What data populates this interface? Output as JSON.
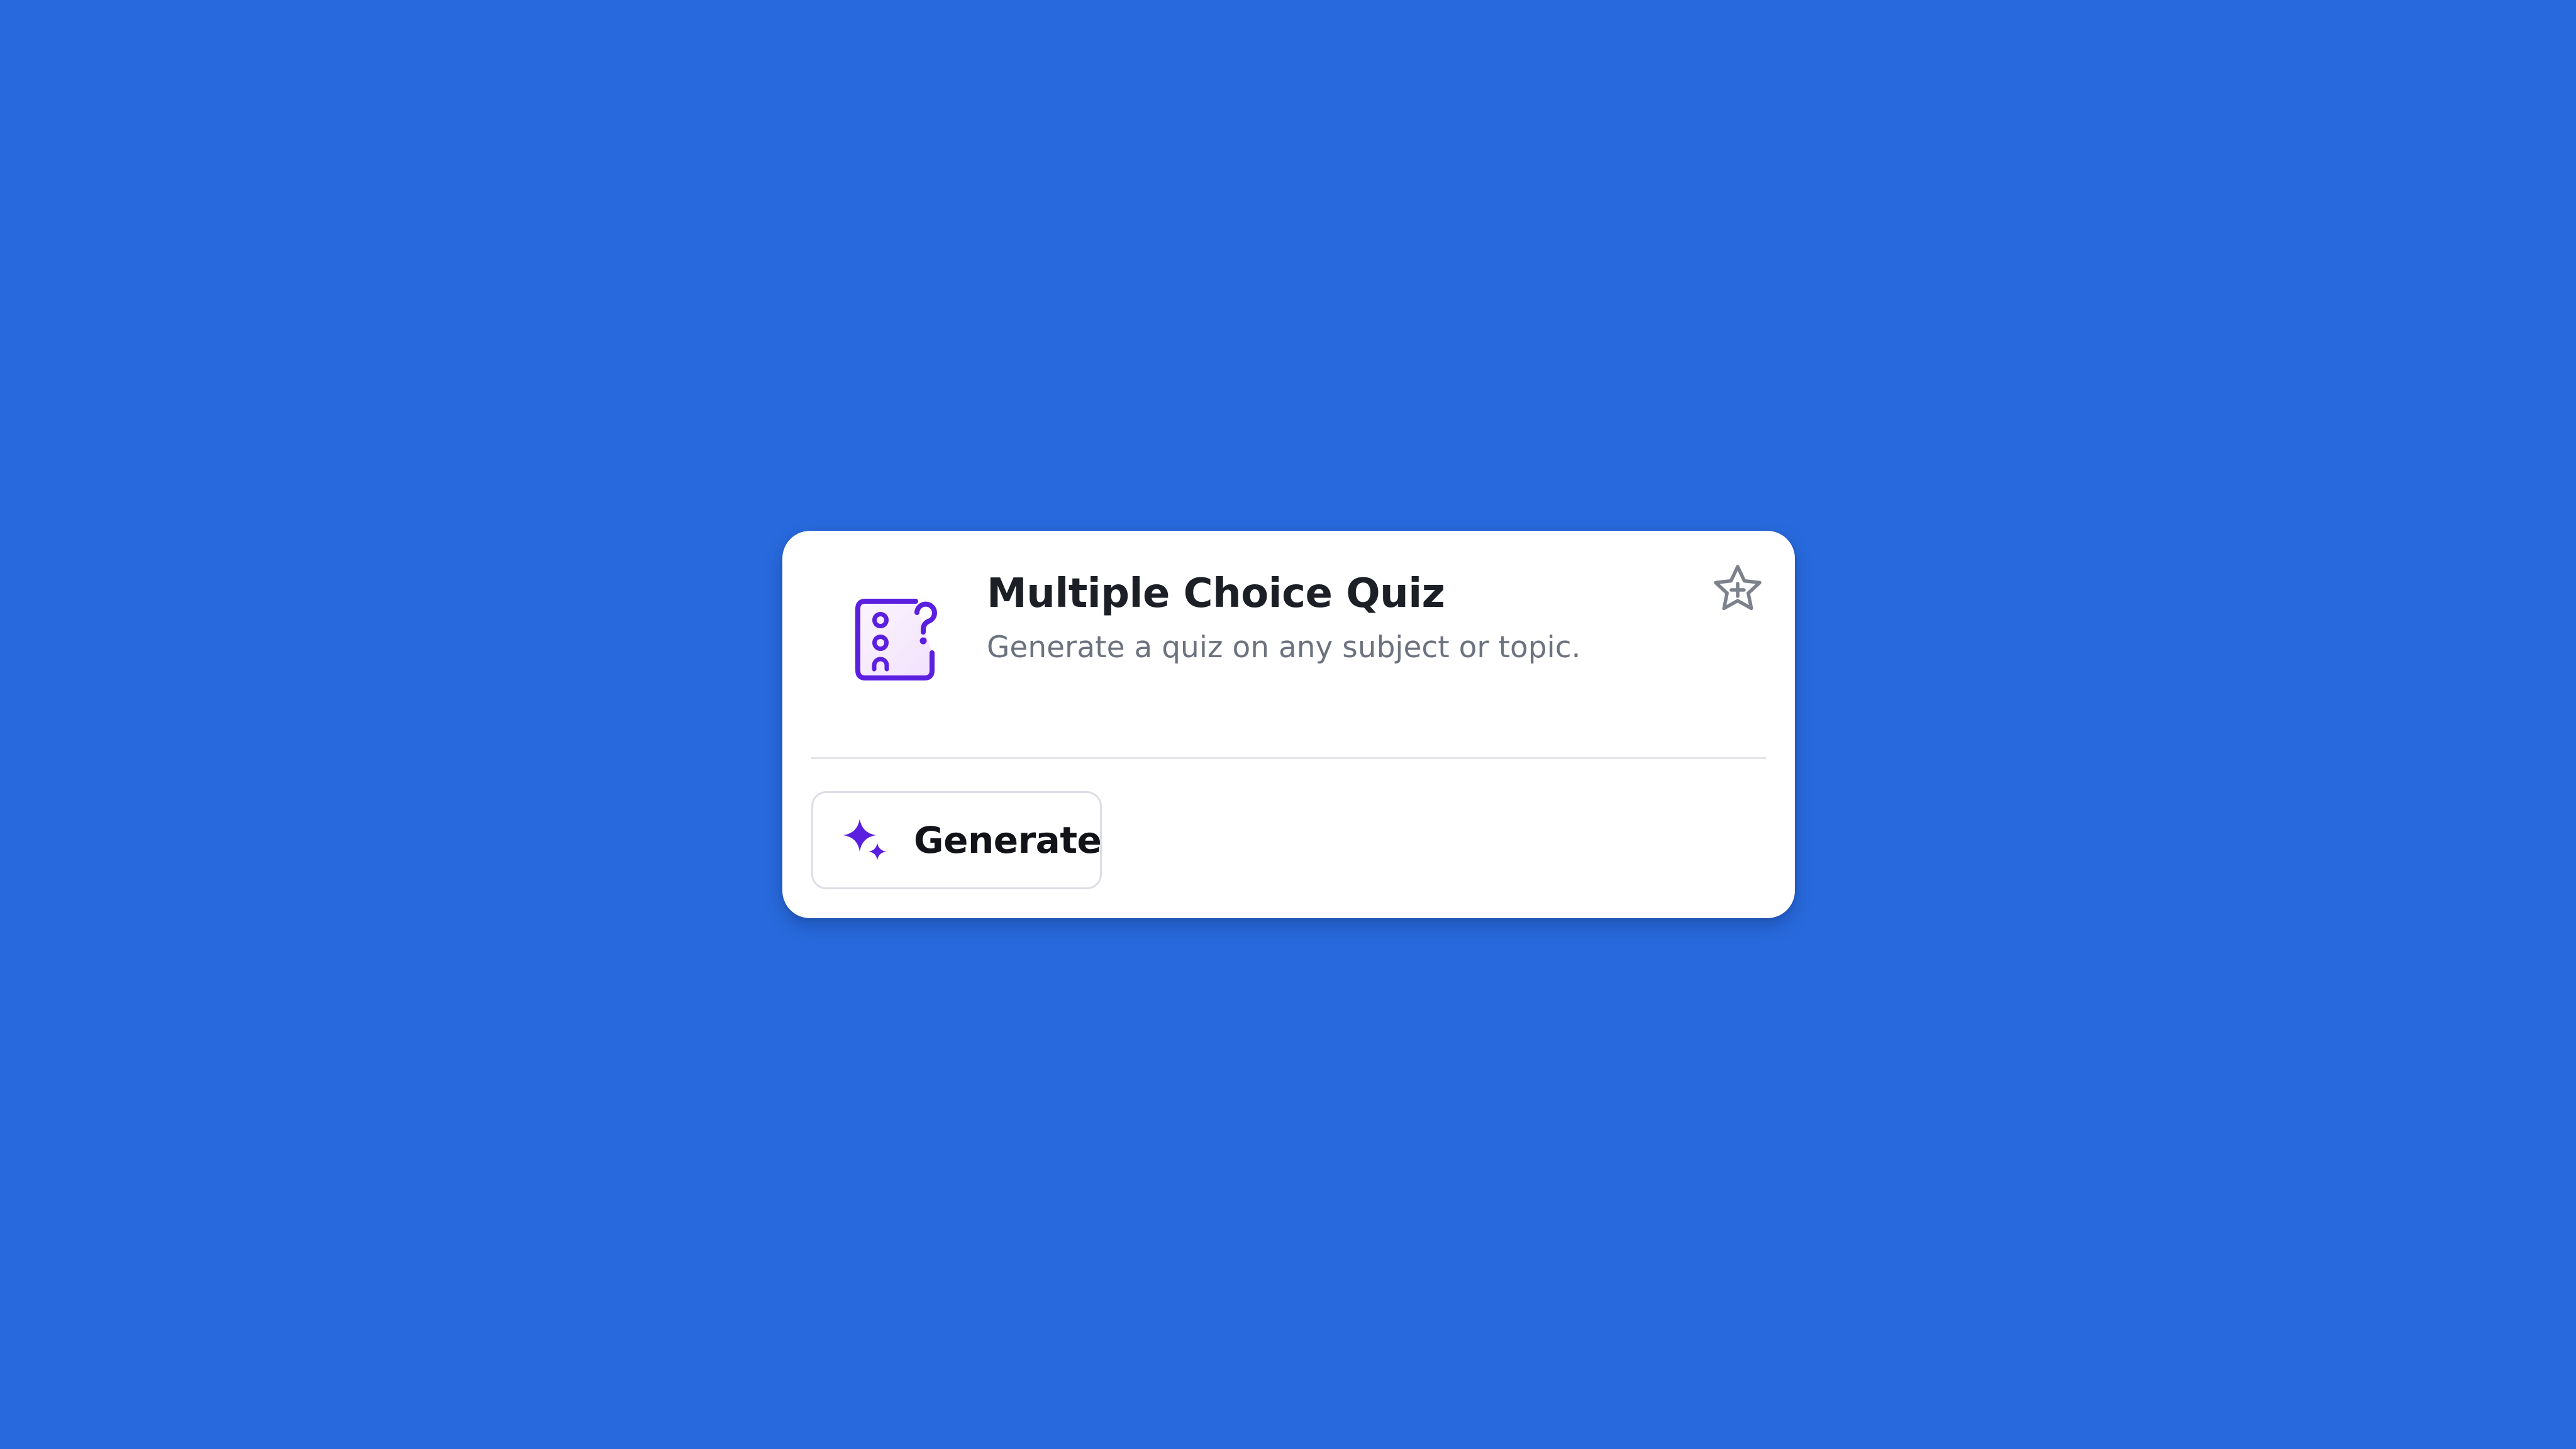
{
  "card": {
    "title": "Multiple Choice Quiz",
    "description": "Generate a quiz on any subject or topic.",
    "icon": "quiz-list-question-icon",
    "favorite_icon": "star-add-icon",
    "generate": {
      "label": "Generate",
      "icon": "sparkle-icon"
    }
  },
  "colors": {
    "background": "#286add",
    "accent": "#5b1fe0",
    "icon_fill": "#f3e8fb",
    "title": "#1c1f26",
    "description": "#6c727e"
  }
}
